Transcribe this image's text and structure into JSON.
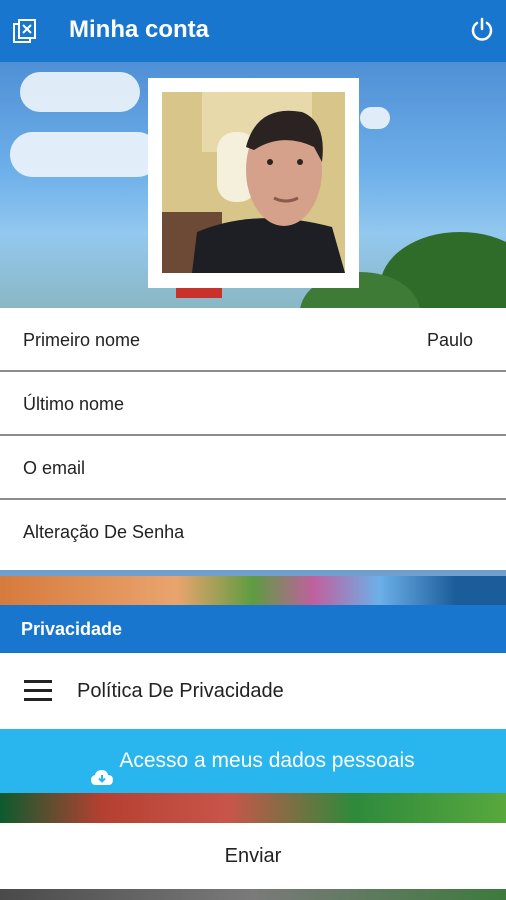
{
  "appbar": {
    "title": "Minha conta",
    "left_icon": "close-document-icon",
    "right_icon": "power-icon"
  },
  "form": {
    "first_name_label": "Primeiro nome",
    "first_name_value": "Paulo",
    "last_name_label": "Último nome",
    "email_label": "O email",
    "password_label": "Alteração De Senha"
  },
  "privacy": {
    "section_title": "Privacidade",
    "policy_label": "Política De Privacidade",
    "policy_icon": "menu-icon",
    "access_label": "Acesso a meus dados pessoais",
    "access_icon": "cloud-download-icon"
  },
  "footer": {
    "send_label": "Enviar"
  },
  "colors": {
    "primary": "#1976cf",
    "accent_button": "#29b6ee"
  }
}
